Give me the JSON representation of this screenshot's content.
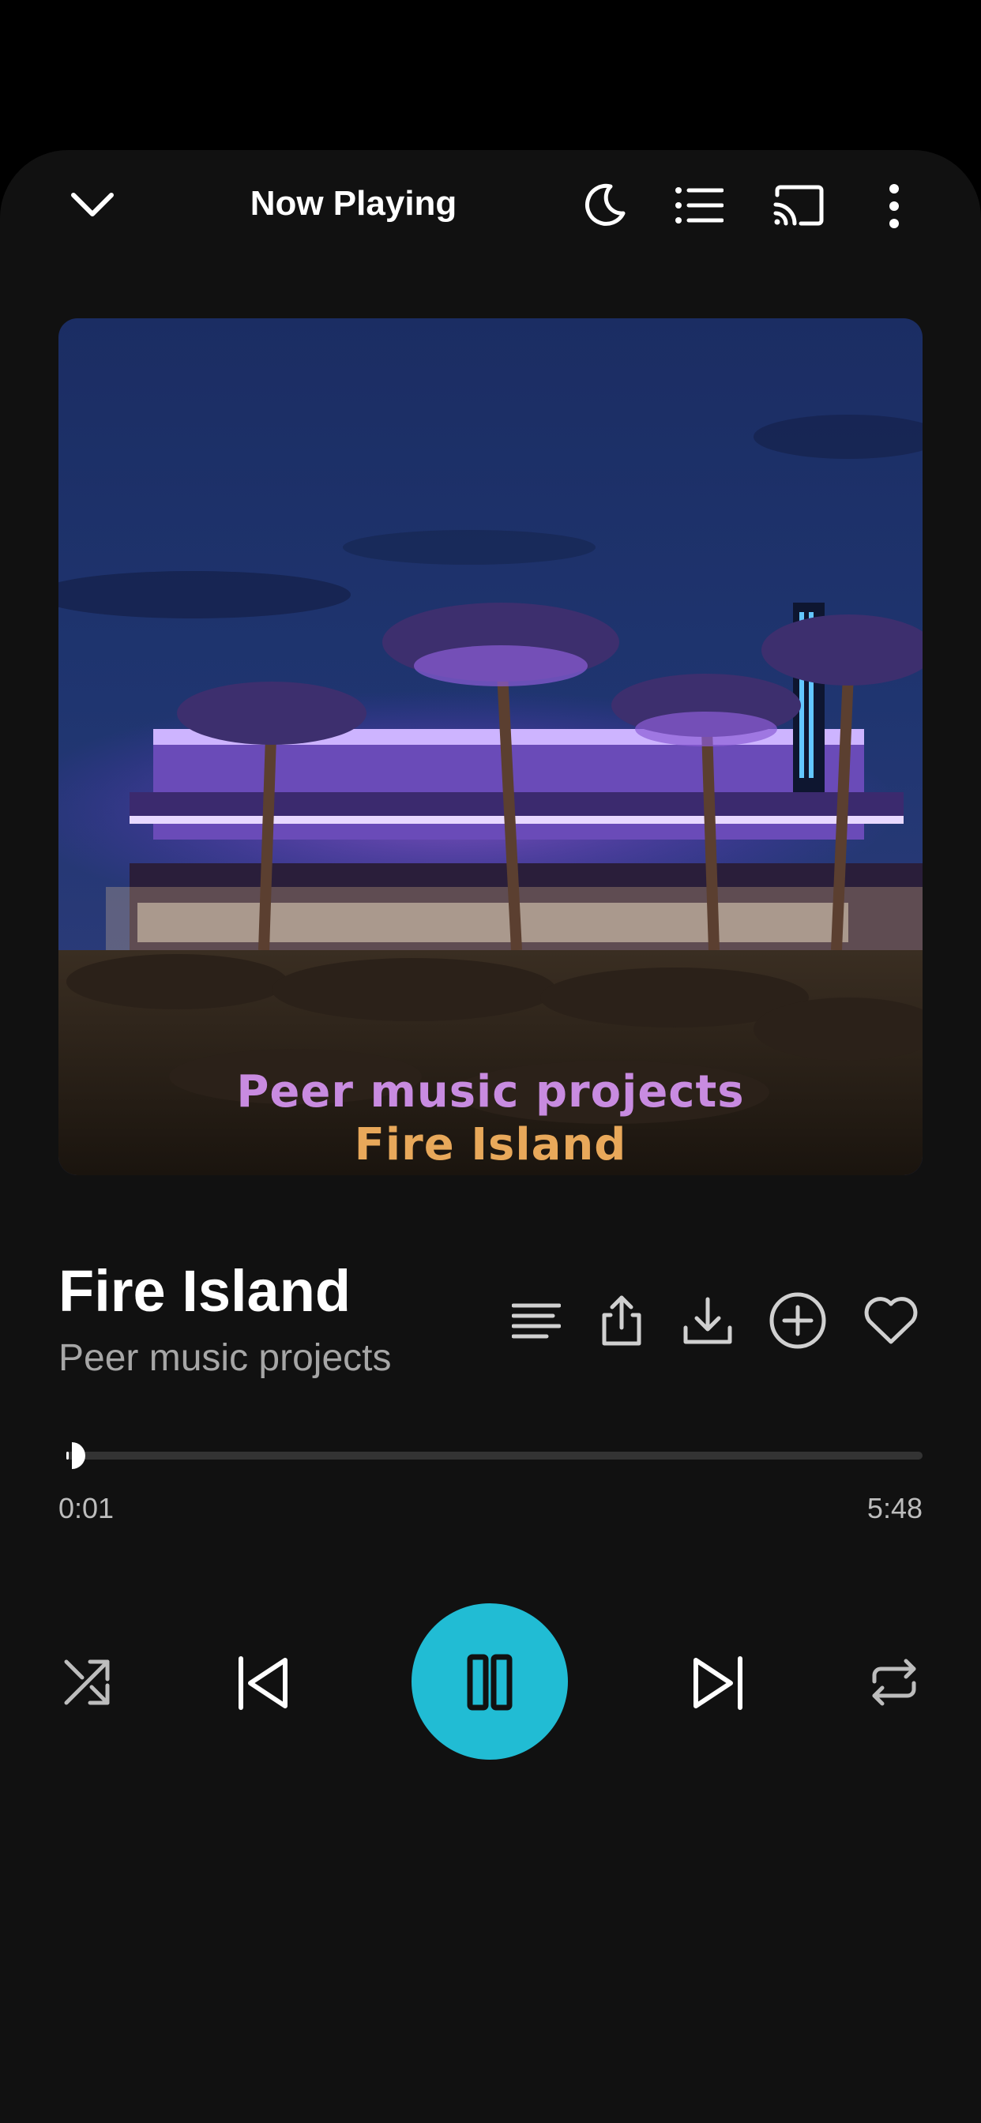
{
  "header": {
    "title": "Now Playing",
    "icons": [
      "chevron-down-icon",
      "sleep-timer-moon-icon",
      "queue-list-icon",
      "cast-icon",
      "more-vertical-icon"
    ]
  },
  "album_art": {
    "caption_line1": "Peer music projects",
    "caption_line2": "Fire Island"
  },
  "track": {
    "title": "Fire Island",
    "artist": "Peer music projects"
  },
  "actions": [
    "lyrics-icon",
    "share-icon",
    "download-icon",
    "add-to-playlist-icon",
    "favorite-heart-icon"
  ],
  "progress": {
    "elapsed": "0:01",
    "duration": "5:48",
    "fraction": 0.003
  },
  "controls": [
    "shuffle-icon",
    "previous-icon",
    "pause-icon",
    "next-icon",
    "repeat-icon"
  ],
  "colors": {
    "accent": "#21bcd4",
    "background": "#111111",
    "secondary_text": "#a6a6a6"
  }
}
